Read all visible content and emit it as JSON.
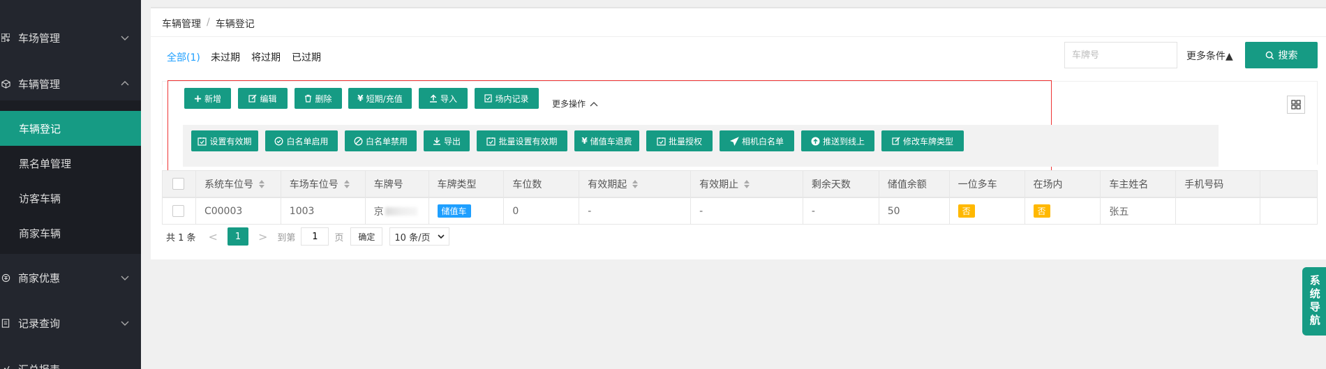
{
  "sidebar": {
    "groups": [
      {
        "label": "车场管理",
        "icon": "grid-icon"
      },
      {
        "label": "车辆管理",
        "icon": "cube-icon"
      },
      {
        "label": "商家优惠",
        "icon": "coupon-icon"
      },
      {
        "label": "记录查询",
        "icon": "document-icon"
      },
      {
        "label": "汇总报表",
        "icon": "chart-icon"
      }
    ],
    "sub_items": [
      "车辆登记",
      "黑名单管理",
      "访客车辆",
      "商家车辆"
    ]
  },
  "breadcrumb": {
    "parent": "车辆管理",
    "separator": "/",
    "current": "车辆登记"
  },
  "tabs": [
    "全部(1)",
    "未过期",
    "将过期",
    "已过期"
  ],
  "search": {
    "placeholder": "车牌号",
    "more_conditions": "更多条件▲",
    "button": "搜索"
  },
  "toolbar": {
    "row1": [
      "新增",
      "编辑",
      "删除",
      "短期/充值",
      "导入",
      "场内记录"
    ],
    "more_ops": "更多操作",
    "row2": [
      "设置有效期",
      "白名单启用",
      "白名单禁用",
      "导出",
      "批量设置有效期",
      "储值车退费",
      "批量授权",
      "相机白名单",
      "推送到线上",
      "修改车牌类型"
    ]
  },
  "table": {
    "headers": [
      "系统车位号",
      "车场车位号",
      "车牌号",
      "车牌类型",
      "车位数",
      "有效期起",
      "有效期止",
      "剩余天数",
      "储值余额",
      "一位多车",
      "在场内",
      "车主姓名",
      "手机号码"
    ],
    "rows": [
      {
        "system_slot": "C00003",
        "lot_slot": "1003",
        "plate_prefix": "京",
        "plate_type": "储值车",
        "slots": "0",
        "valid_from": "-",
        "valid_to": "-",
        "days_left": "-",
        "balance": "50",
        "multi_car": "否",
        "in_lot": "否",
        "owner": "张五",
        "phone": ""
      }
    ]
  },
  "pagination": {
    "total": "共 1 条",
    "prev": "<",
    "current_page": "1",
    "next": ">",
    "goto_label": "到第",
    "goto_value": "1",
    "page_unit": "页",
    "confirm": "确定",
    "page_size": "10 条/页"
  },
  "system_nav": "系统导航",
  "colors": {
    "primary": "#169b84",
    "sidebar": "#23262e",
    "tab_active": "#1e9fff",
    "tag_blue": "#1e9fff",
    "tag_orange": "#ffb800",
    "highlight": "#e33333"
  }
}
